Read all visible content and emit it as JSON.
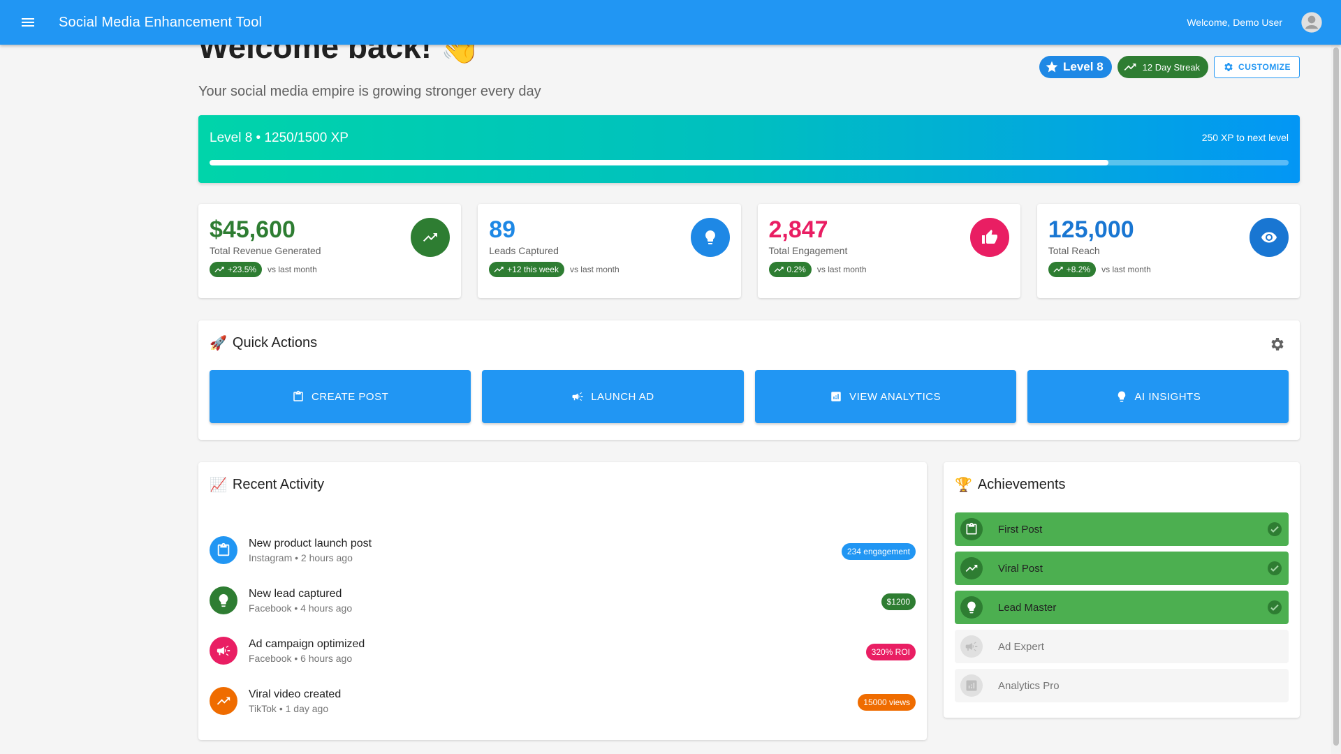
{
  "appbar": {
    "title": "Social Media Enhancement Tool",
    "welcome": "Welcome, Demo User"
  },
  "header": {
    "title": "Welcome back! 👋",
    "subtitle": "Your social media empire is growing stronger every day",
    "level_chip": "Level 8",
    "streak_chip": "12 Day Streak",
    "customize_label": "CUSTOMIZE"
  },
  "xp": {
    "label": "Level 8 • 1250/1500 XP",
    "next": "250 XP to next level",
    "progress_fraction": 0.8333
  },
  "stats": [
    {
      "value": "$45,600",
      "label": "Total Revenue Generated",
      "badge": "+23.5%",
      "vs": "vs last month",
      "color": "#2e7d32",
      "icon": "trending-up-icon"
    },
    {
      "value": "89",
      "label": "Leads Captured",
      "badge": "+12 this week",
      "vs": "vs last month",
      "color": "#1e88e5",
      "icon": "lightbulb-icon"
    },
    {
      "value": "2,847",
      "label": "Total Engagement",
      "badge": "0.2%",
      "vs": "vs last month",
      "color": "#e91e63",
      "icon": "thumb-up-icon"
    },
    {
      "value": "125,000",
      "label": "Total Reach",
      "badge": "+8.2%",
      "vs": "vs last month",
      "color": "#1976d2",
      "icon": "eye-icon"
    }
  ],
  "quick_actions": {
    "title": "Quick Actions",
    "emoji": "🚀",
    "buttons": [
      {
        "label": "CREATE POST",
        "icon": "clipboard-icon"
      },
      {
        "label": "LAUNCH AD",
        "icon": "campaign-icon"
      },
      {
        "label": "VIEW ANALYTICS",
        "icon": "analytics-icon"
      },
      {
        "label": "AI INSIGHTS",
        "icon": "lightbulb-icon"
      }
    ]
  },
  "recent": {
    "title": "Recent Activity",
    "emoji": "📈",
    "items": [
      {
        "title": "New product launch post",
        "meta": "Instagram • 2 hours ago",
        "pill": "234 engagement",
        "color": "#2196f3",
        "icon": "clipboard-icon"
      },
      {
        "title": "New lead captured",
        "meta": "Facebook • 4 hours ago",
        "pill": "$1200",
        "color": "#2e7d32",
        "icon": "lightbulb-icon"
      },
      {
        "title": "Ad campaign optimized",
        "meta": "Facebook • 6 hours ago",
        "pill": "320% ROI",
        "color": "#e91e63",
        "icon": "campaign-icon"
      },
      {
        "title": "Viral video created",
        "meta": "TikTok • 1 day ago",
        "pill": "15000 views",
        "color": "#ef6c00",
        "icon": "trending-up-icon"
      }
    ]
  },
  "achievements": {
    "title": "Achievements",
    "emoji": "🏆",
    "items": [
      {
        "label": "First Post",
        "unlocked": true,
        "icon": "clipboard-icon"
      },
      {
        "label": "Viral Post",
        "unlocked": true,
        "icon": "trending-up-icon"
      },
      {
        "label": "Lead Master",
        "unlocked": true,
        "icon": "lightbulb-icon"
      },
      {
        "label": "Ad Expert",
        "unlocked": false,
        "icon": "campaign-icon"
      },
      {
        "label": "Analytics Pro",
        "unlocked": false,
        "icon": "analytics-icon"
      }
    ]
  }
}
